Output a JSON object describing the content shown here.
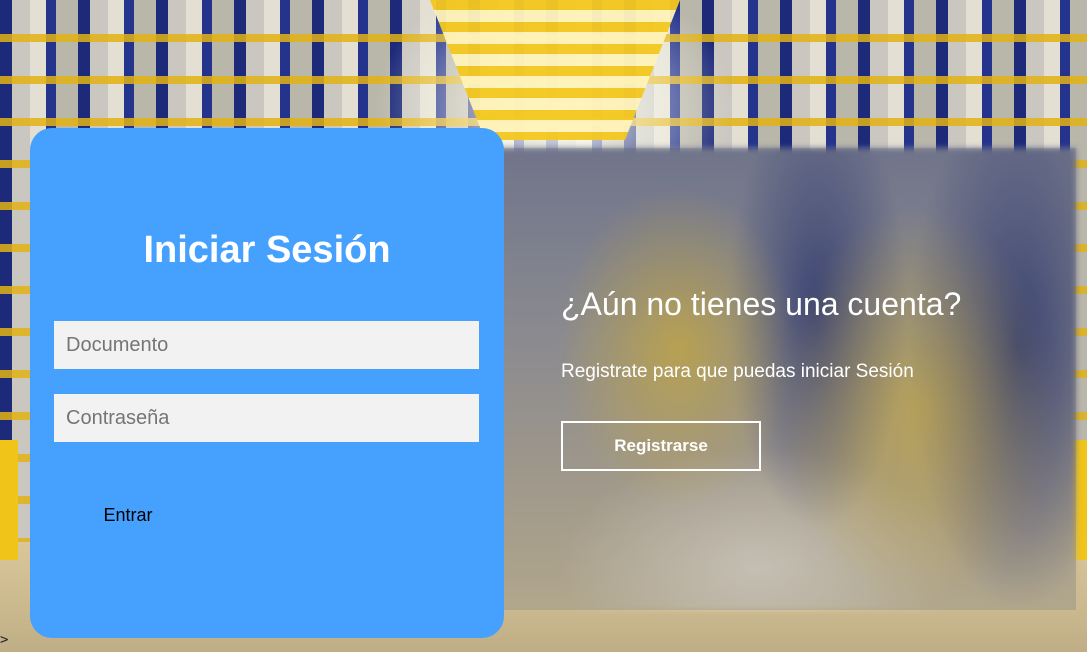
{
  "login": {
    "title": "Iniciar Sesión",
    "document_placeholder": "Documento",
    "document_value": "",
    "password_placeholder": "Contraseña",
    "password_value": "",
    "submit_label": "Entrar"
  },
  "register": {
    "heading": "¿Aún no tienes una cuenta?",
    "subtext": "Registrate para que puedas iniciar Sesión",
    "button_label": "Registrarse"
  },
  "corner": {
    "glyph": ">"
  },
  "colors": {
    "card_background": "#45a1fd",
    "input_background": "#f2f2f2",
    "text_on_dark": "#ffffff"
  }
}
